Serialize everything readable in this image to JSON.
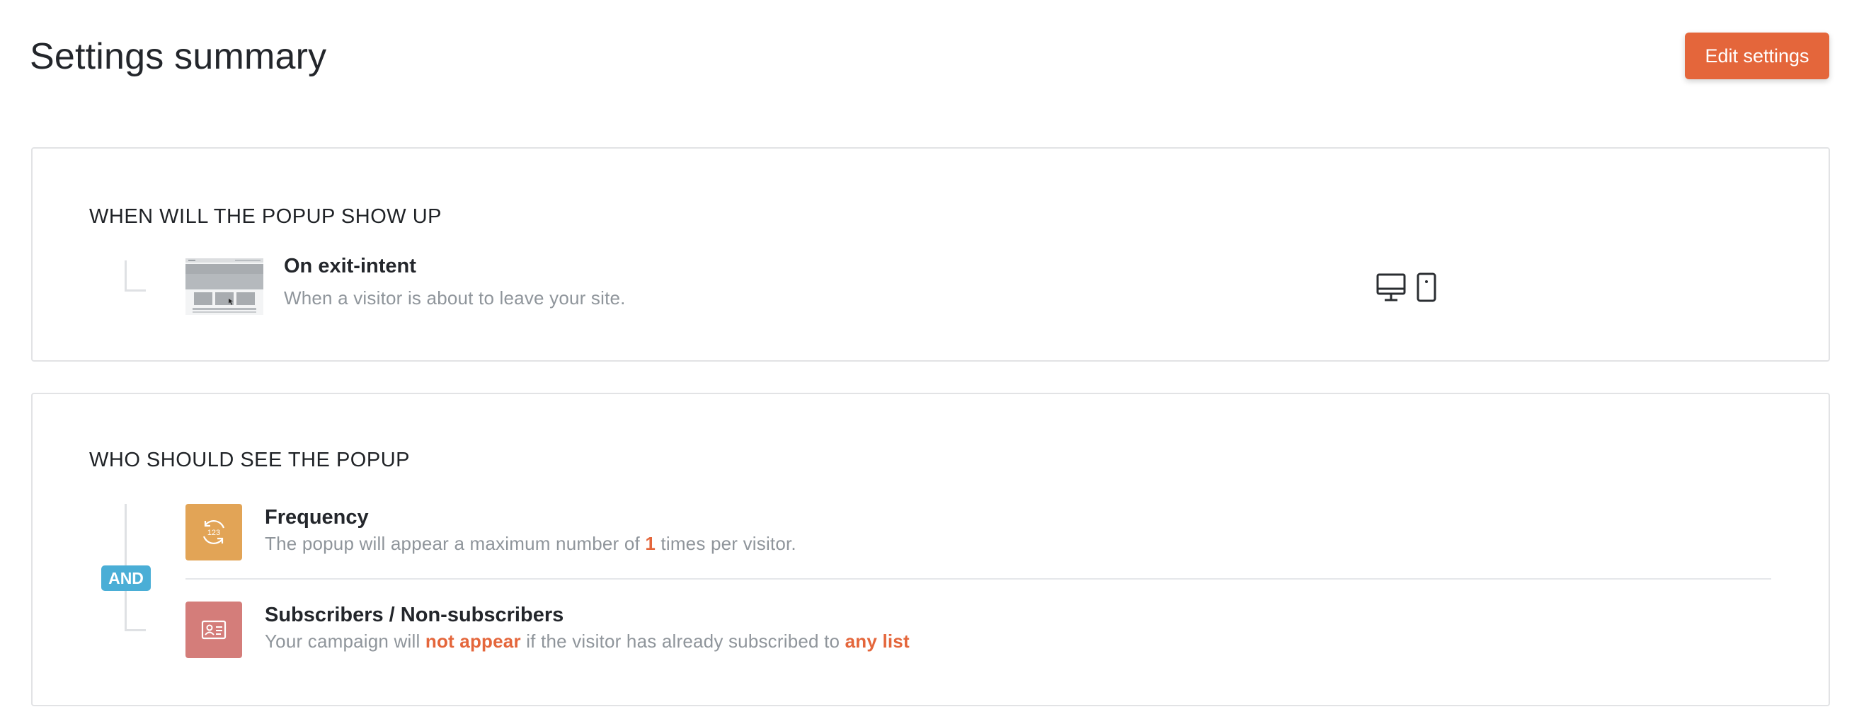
{
  "header": {
    "title": "Settings summary",
    "edit_button": "Edit settings"
  },
  "colors": {
    "accent": "#e4663b",
    "and_badge": "#4aaed6",
    "frequency_icon_bg": "#e2a456",
    "subscribers_icon_bg": "#d47d7a"
  },
  "when_section": {
    "title": "WHEN WILL THE POPUP SHOW UP",
    "rule": {
      "title": "On exit-intent",
      "description": "When a visitor is about to leave your site.",
      "thumbnail_icon": "exit-intent-thumbnail",
      "devices": [
        "desktop-icon",
        "mobile-icon"
      ]
    }
  },
  "who_section": {
    "title": "WHO SHOULD SEE THE POPUP",
    "operator": "AND",
    "rules": [
      {
        "title": "Frequency",
        "icon": "frequency-123-icon",
        "desc_before": "The popup will appear a maximum number of ",
        "desc_highlight": "1",
        "desc_after": " times per visitor."
      },
      {
        "title": "Subscribers / Non-subscribers",
        "icon": "id-card-icon",
        "desc_part1": "Your campaign will ",
        "desc_highlight1": "not appear",
        "desc_part2": " if the visitor has already subscribed to ",
        "desc_highlight2": "any list"
      }
    ]
  }
}
